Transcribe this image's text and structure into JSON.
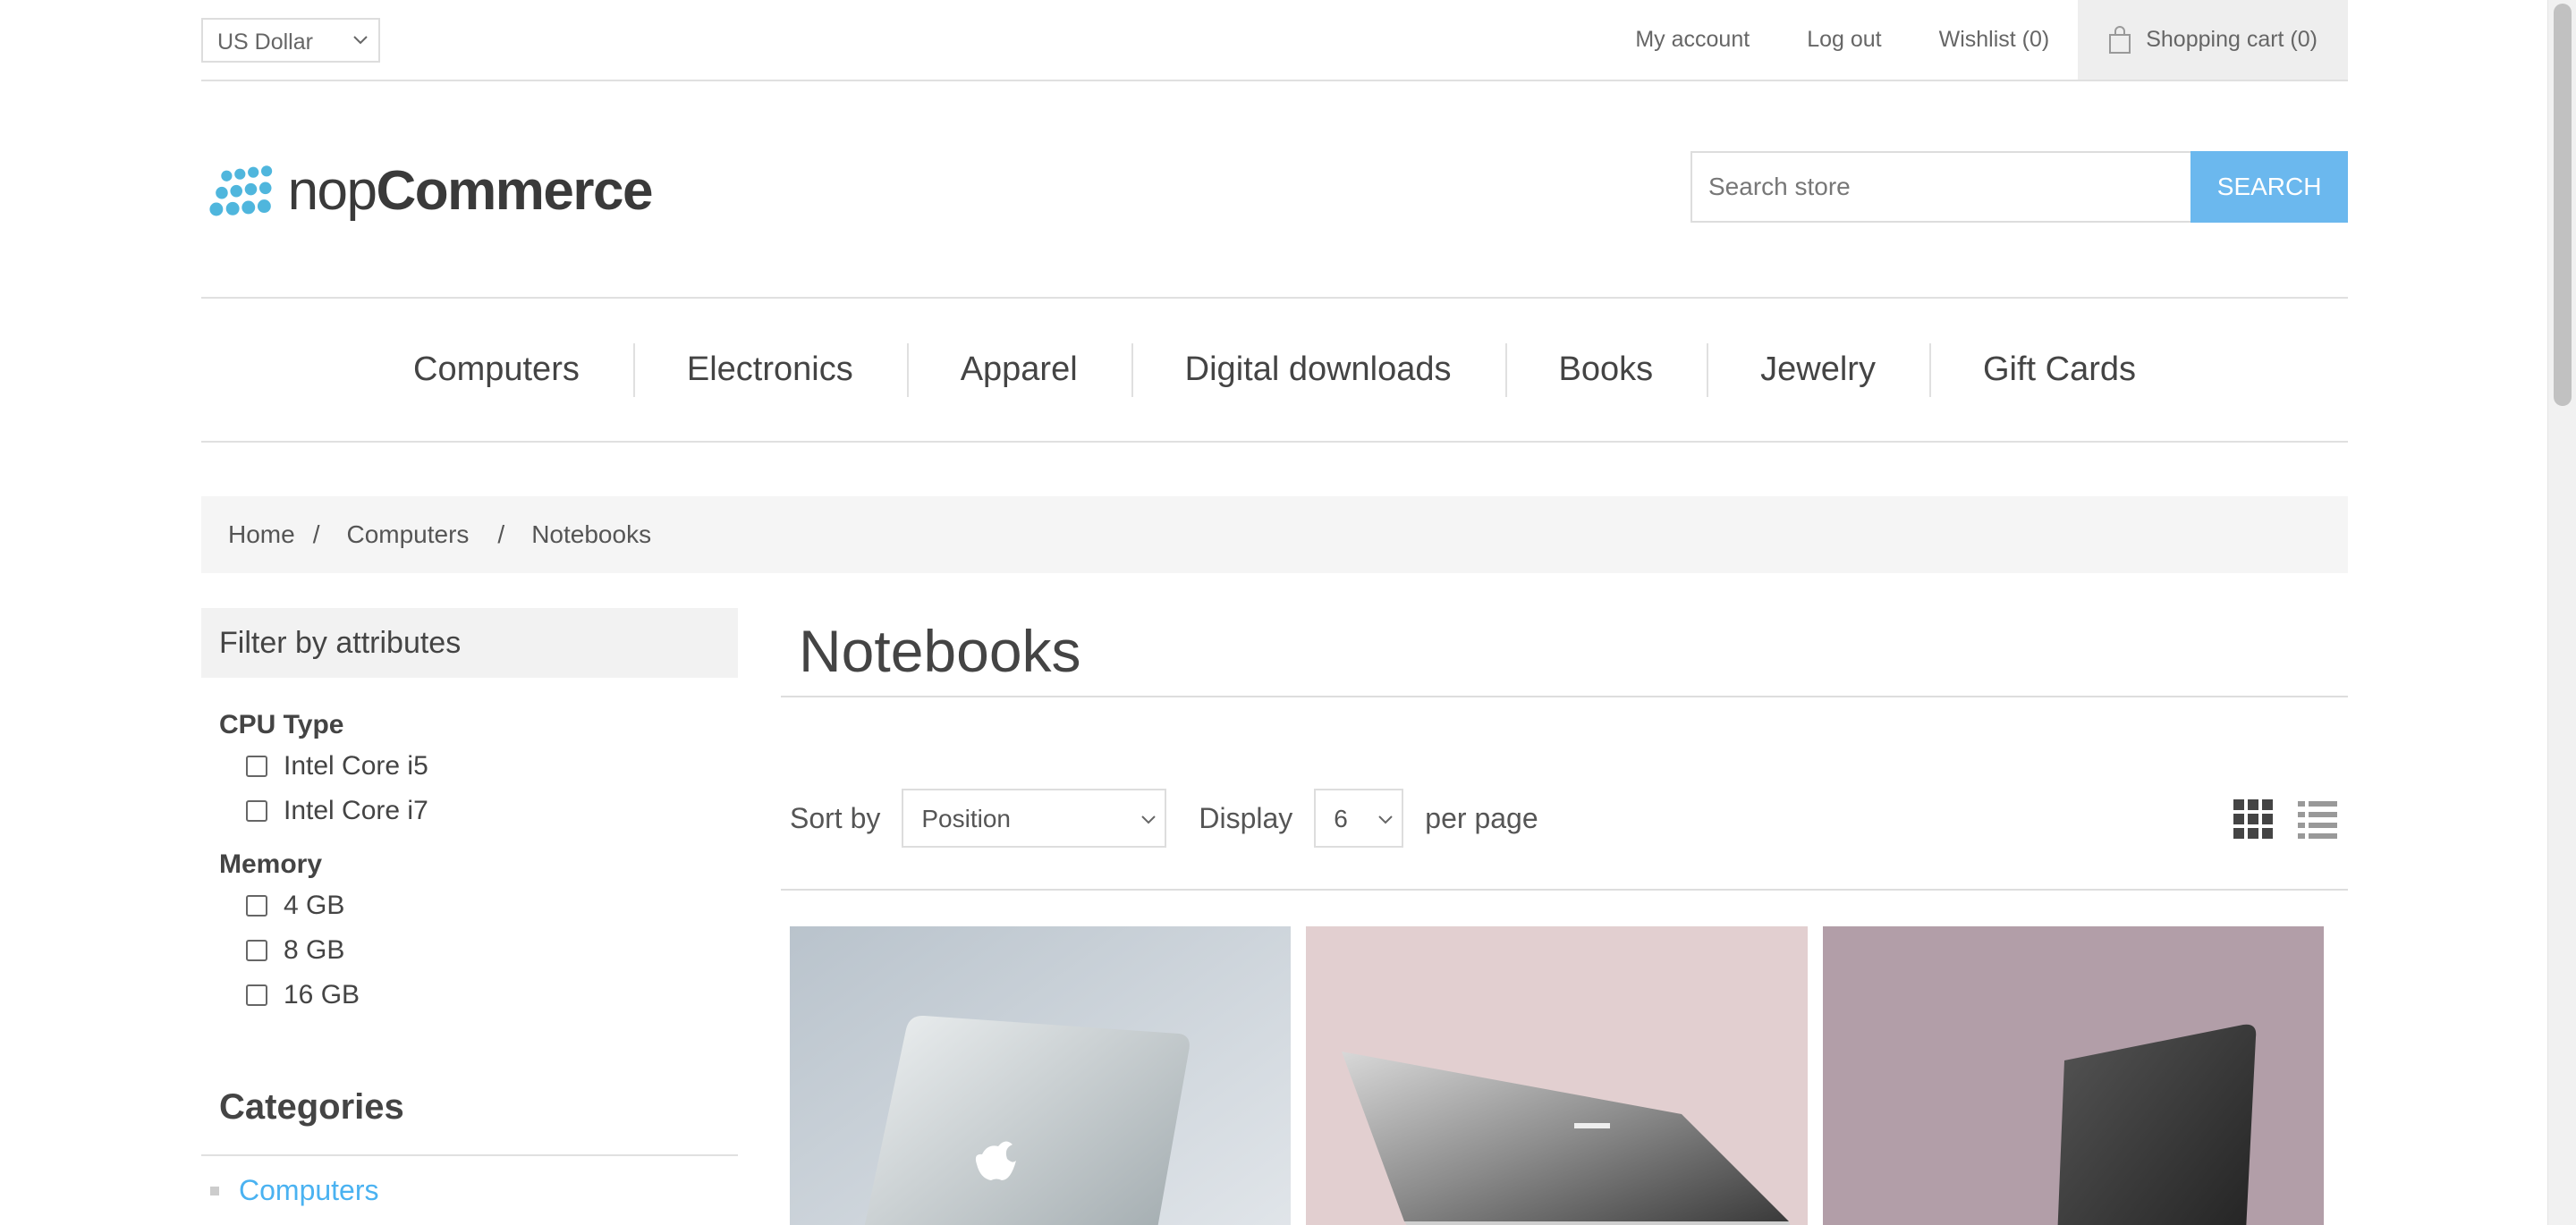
{
  "header": {
    "currency": "US Dollar",
    "links": {
      "my_account": "My account",
      "log_out": "Log out",
      "wishlist": "Wishlist (0)",
      "cart": "Shopping cart (0)"
    }
  },
  "logo": {
    "part1": "nop",
    "part2": "Commerce"
  },
  "search": {
    "placeholder": "Search store",
    "button": "Search"
  },
  "menu": [
    "Computers",
    "Electronics",
    "Apparel",
    "Digital downloads",
    "Books",
    "Jewelry",
    "Gift Cards"
  ],
  "breadcrumb": {
    "home": "Home",
    "sep": "/",
    "parent": "Computers",
    "current": "Notebooks"
  },
  "sidebar": {
    "filter_title": "Filter by attributes",
    "groups": [
      {
        "name": "CPU Type",
        "options": [
          "Intel Core i5",
          "Intel Core i7"
        ]
      },
      {
        "name": "Memory",
        "options": [
          "4 GB",
          "8 GB",
          "16 GB"
        ]
      }
    ],
    "categories_title": "Categories",
    "categories": [
      "Computers"
    ]
  },
  "main": {
    "title": "Notebooks",
    "sort_label": "Sort by",
    "sort_value": "Position",
    "display_label": "Display",
    "display_value": "6",
    "per_page": "per page"
  },
  "colors": {
    "accent": "#4ab2f1",
    "search_button": "#6bb8ee"
  },
  "icons": [
    "chevron-down-icon",
    "shopping-bag-icon",
    "grid-view-icon",
    "list-view-icon"
  ]
}
